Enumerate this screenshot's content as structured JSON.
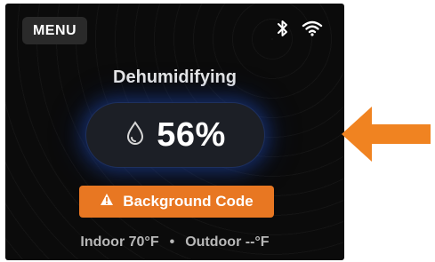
{
  "header": {
    "menu_label": "MENU",
    "icons": [
      "bluetooth-icon",
      "wifi-icon"
    ]
  },
  "main": {
    "mode_title": "Dehumidifying",
    "humidity_value": "56%",
    "humidity_icon": "water-drop-icon",
    "alert": {
      "icon": "warning-icon",
      "label": "Background Code",
      "color": "#e87722"
    }
  },
  "footer": {
    "indoor": "Indoor 70°F",
    "separator": "•",
    "outdoor": "Outdoor --°F"
  },
  "annotation": {
    "icon": "pointer-arrow-icon",
    "color": "#f08321"
  }
}
